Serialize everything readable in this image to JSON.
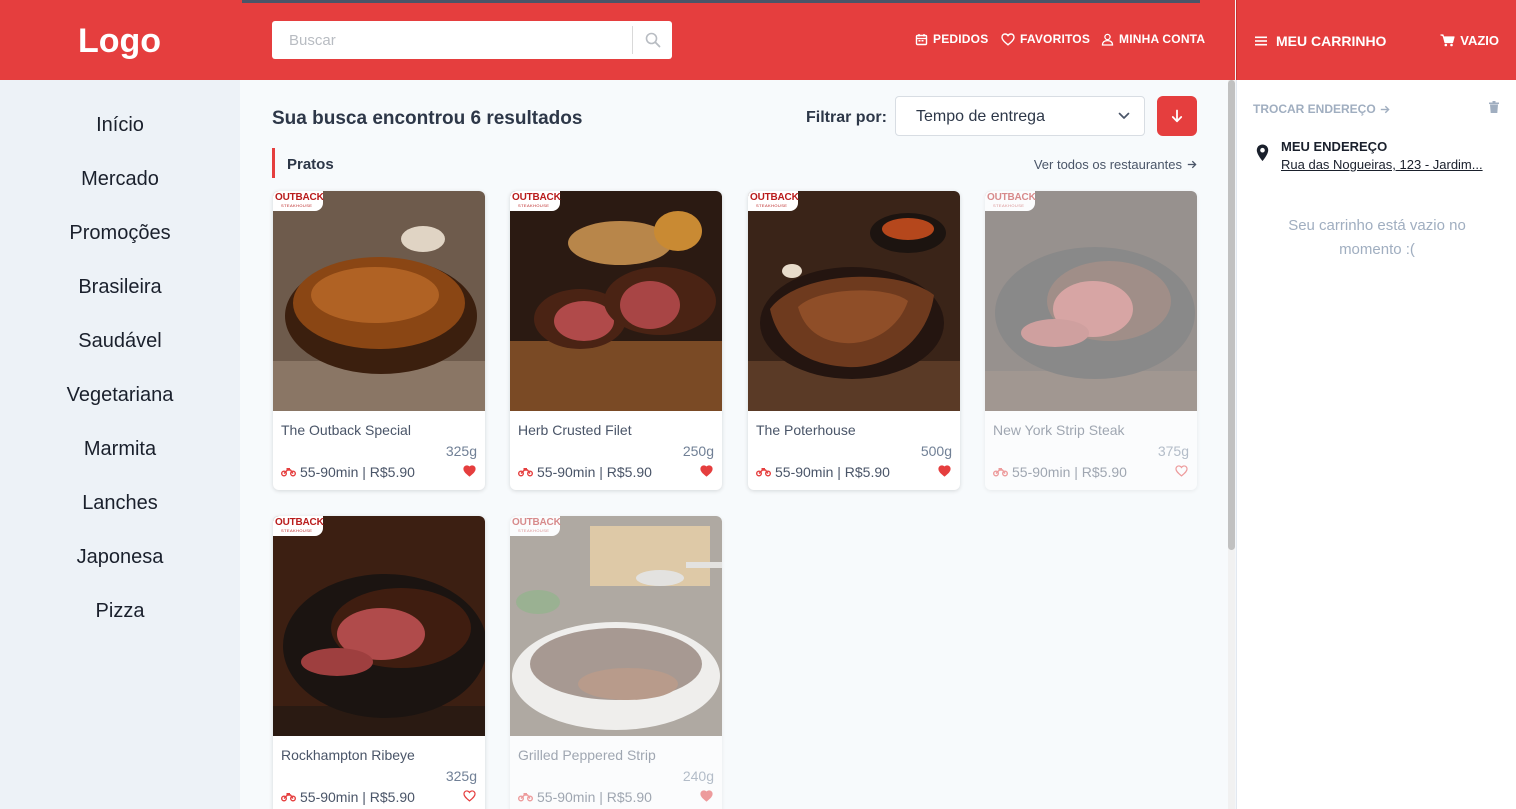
{
  "header": {
    "logo": "Logo",
    "search_placeholder": "Buscar",
    "nav": [
      {
        "label": "PEDIDOS",
        "icon": "calendar-icon"
      },
      {
        "label": "FAVORITOS",
        "icon": "heart-icon"
      },
      {
        "label": "MINHA CONTA",
        "icon": "user-icon"
      }
    ],
    "cart_title": "MEU CARRINHO",
    "cart_status": "VAZIO"
  },
  "sidebar": {
    "items": [
      "Início",
      "Mercado",
      "Promoções",
      "Brasileira",
      "Saudável",
      "Vegetariana",
      "Marmita",
      "Lanches",
      "Japonesa",
      "Pizza"
    ]
  },
  "main": {
    "results_title": "Sua busca encontrou 6 resultados",
    "filter_label": "Filtrar por:",
    "filter_value": "Tempo de entrega",
    "section_title": "Pratos",
    "see_all": "Ver todos os restaurantes",
    "brand_name": "OUTBACK",
    "brand_sub": "STEAKHOUSE",
    "products": [
      {
        "name": "The Outback Special",
        "weight": "325g",
        "meta": "55-90min | R$5.90",
        "favorite": true,
        "available": true
      },
      {
        "name": "Herb Crusted Filet",
        "weight": "250g",
        "meta": "55-90min | R$5.90",
        "favorite": true,
        "available": true
      },
      {
        "name": "The Poterhouse",
        "weight": "500g",
        "meta": "55-90min | R$5.90",
        "favorite": true,
        "available": true
      },
      {
        "name": "New York Strip Steak",
        "weight": "375g",
        "meta": "55-90min | R$5.90",
        "favorite": false,
        "available": false
      },
      {
        "name": "Rockhampton Ribeye",
        "weight": "325g",
        "meta": "55-90min | R$5.90",
        "favorite": false,
        "available": true
      },
      {
        "name": "Grilled Peppered Strip",
        "weight": "240g",
        "meta": "55-90min | R$5.90",
        "favorite": true,
        "available": false
      }
    ]
  },
  "cart": {
    "change_address": "TROCAR ENDEREÇO",
    "address_label": "MEU ENDEREÇO",
    "address_value": "Rua das Nogueiras, 123 - Jardim...",
    "empty_message": "Seu carrinho está vazio no momento :("
  },
  "colors": {
    "accent": "#e53e3e",
    "sidebar_bg": "#edf2f7",
    "muted": "#a0aec0"
  }
}
